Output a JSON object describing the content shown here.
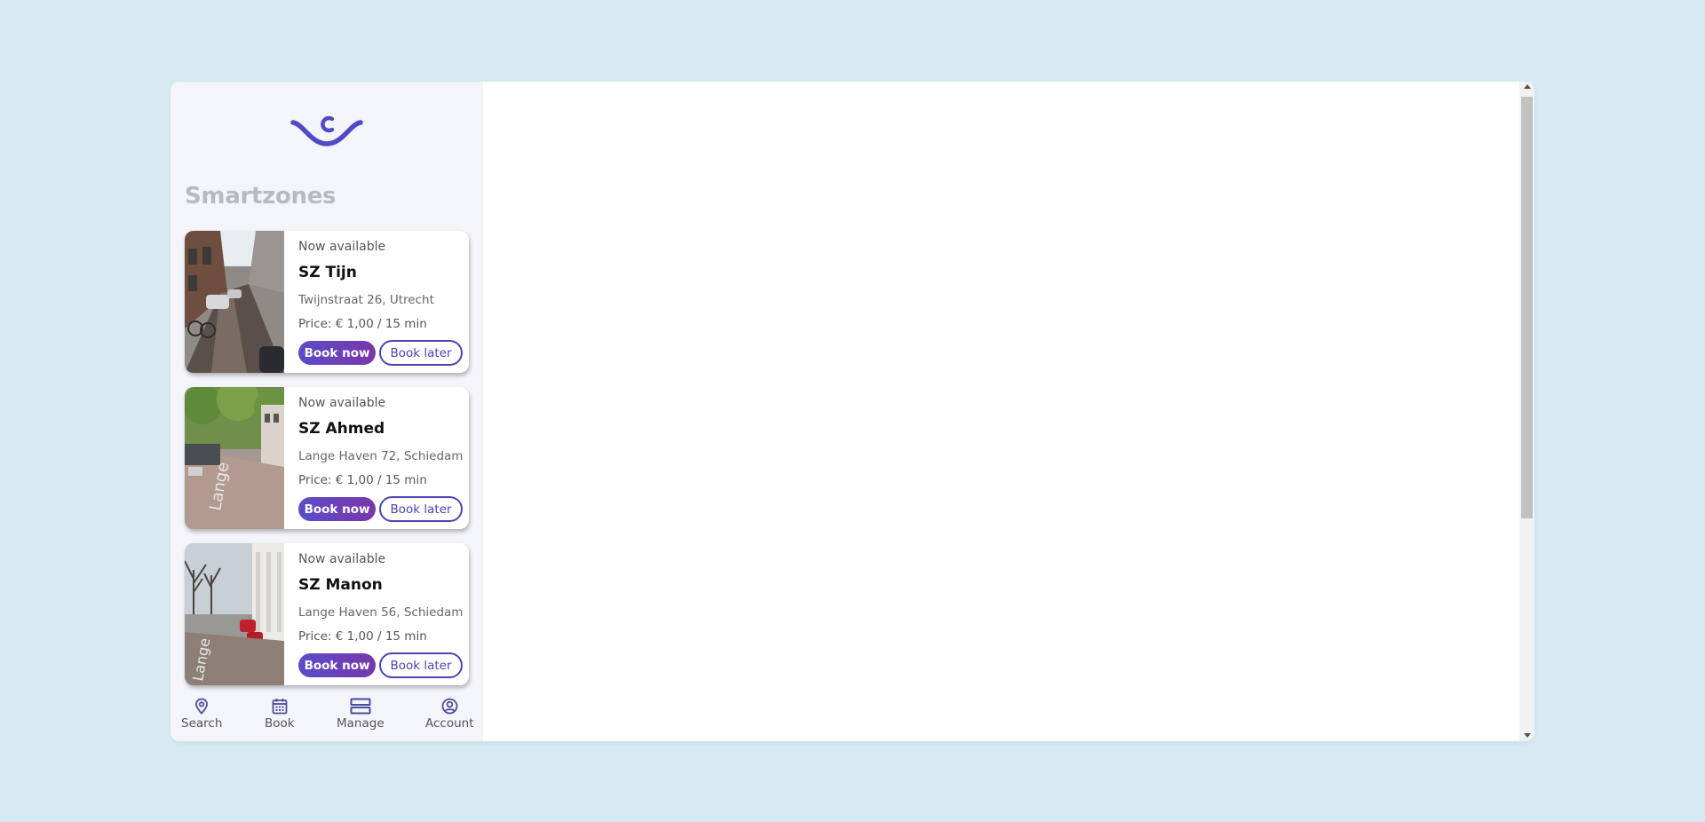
{
  "sidebar": {
    "title": "Smartzones",
    "cards": [
      {
        "status": "Now available",
        "name": "SZ Tijn",
        "address": "Twijnstraat 26, Utrecht",
        "price": "Price: € 1,00 / 15 min",
        "book_now": "Book now",
        "book_later": "Book later"
      },
      {
        "status": "Now available",
        "name": "SZ Ahmed",
        "address": "Lange Haven 72, Schiedam",
        "price": "Price: € 1,00 / 15 min",
        "book_now": "Book now",
        "book_later": "Book later"
      },
      {
        "status": "Now available",
        "name": "SZ Manon",
        "address": "Lange Haven 56, Schiedam",
        "price": "Price: € 1,00 / 15 min",
        "book_now": "Book now",
        "book_later": "Book later"
      }
    ]
  },
  "bottom_nav": [
    {
      "label": "Search",
      "icon": "location-pin-icon"
    },
    {
      "label": "Book",
      "icon": "calendar-icon"
    },
    {
      "label": "Manage",
      "icon": "list-rows-icon"
    },
    {
      "label": "Account",
      "icon": "user-circle-icon"
    }
  ],
  "colors": {
    "brand": "#5a4cc8",
    "brand_gradient_end": "#7a37ab",
    "outline_button": "#4b45b3",
    "page_background": "#d7e9f1",
    "sidebar_background": "#f4f4fb"
  }
}
